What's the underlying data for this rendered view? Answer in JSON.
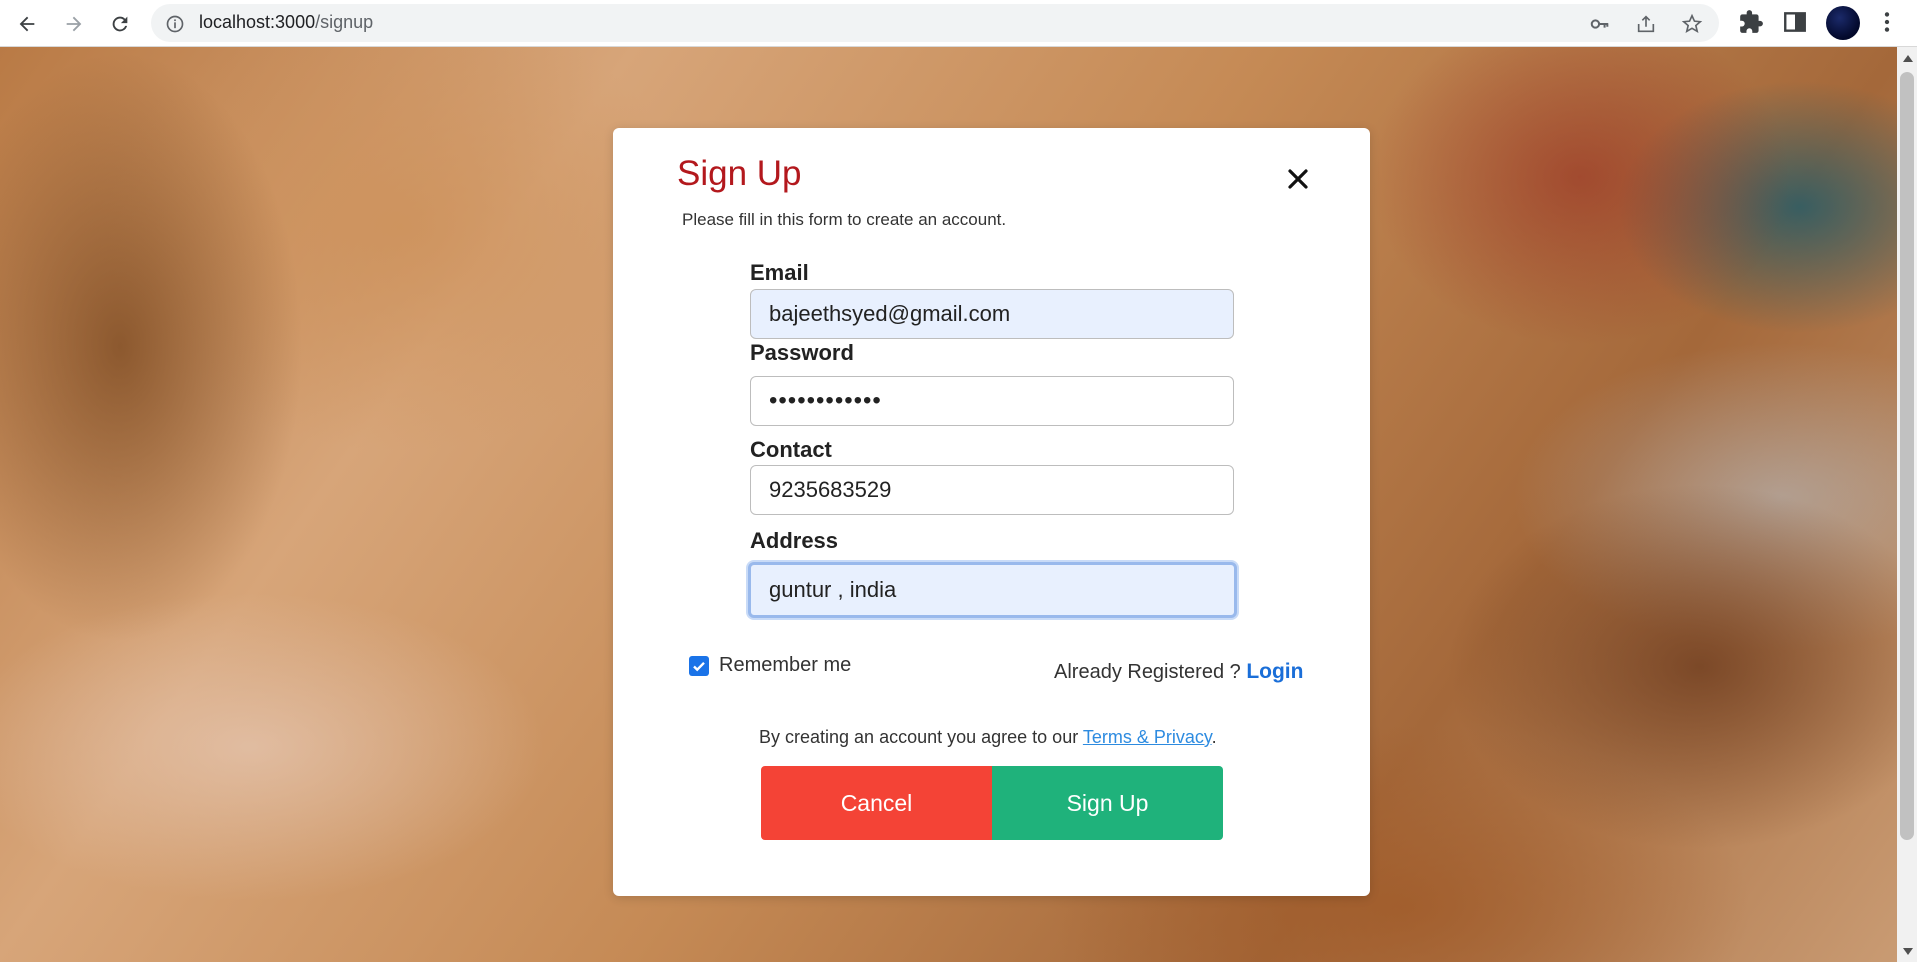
{
  "browser": {
    "url_host": "localhost:3000",
    "url_path": "/signup"
  },
  "form": {
    "title": "Sign Up",
    "subtitle": "Please fill in this form to create an account.",
    "email_label": "Email",
    "email_value": "bajeethsyed@gmail.com",
    "password_label": "Password",
    "password_value": "••••••••••••",
    "contact_label": "Contact",
    "contact_value": "9235683529",
    "address_label": "Address",
    "address_value": "guntur , india",
    "remember_label": "Remember me",
    "remember_checked": true,
    "already_text": "Already Registered ? ",
    "login_label": "Login",
    "terms_text": "By creating an account you agree to our ",
    "terms_link": "Terms & Privacy",
    "terms_end": ".",
    "cancel_label": "Cancel",
    "signup_label": "Sign Up"
  },
  "colors": {
    "title": "#b3181d",
    "cancel": "#f44336",
    "signup": "#1fb27b",
    "link": "#1a6ed8"
  }
}
